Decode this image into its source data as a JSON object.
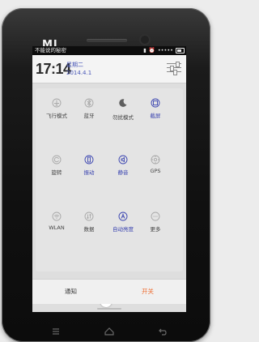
{
  "device": {
    "brand_logo": "MI"
  },
  "status_bar": {
    "carrier_text": "不能说的秘密",
    "signal_dots": "•••••"
  },
  "header": {
    "time": "17:14",
    "weekday": "星期二",
    "date": "2014.4.1"
  },
  "toggles": [
    {
      "label": "飞行模式",
      "icon": "airplane-icon",
      "active": false
    },
    {
      "label": "蓝牙",
      "icon": "bluetooth-icon",
      "active": false
    },
    {
      "label": "勿扰模式",
      "icon": "moon-icon",
      "active": false
    },
    {
      "label": "截屏",
      "icon": "screenshot-icon",
      "active": true
    },
    {
      "label": "旋转",
      "icon": "rotate-icon",
      "active": false
    },
    {
      "label": "振动",
      "icon": "vibrate-icon",
      "active": true
    },
    {
      "label": "静音",
      "icon": "mute-icon",
      "active": true
    },
    {
      "label": "GPS",
      "icon": "gps-icon",
      "active": false
    },
    {
      "label": "WLAN",
      "icon": "wifi-icon",
      "active": false
    },
    {
      "label": "数据",
      "icon": "data-icon",
      "active": false
    },
    {
      "label": "自动亮度",
      "icon": "auto-brightness-icon",
      "active": true
    },
    {
      "label": "更多",
      "icon": "more-icon",
      "active": false
    }
  ],
  "brightness": {
    "level": 0.5
  },
  "tabs": {
    "notifications": "通知",
    "toggles": "开关"
  },
  "colors": {
    "accent": "#3a44b0",
    "active_tab": "#ee6b2e",
    "slider": "#4b78d0"
  }
}
